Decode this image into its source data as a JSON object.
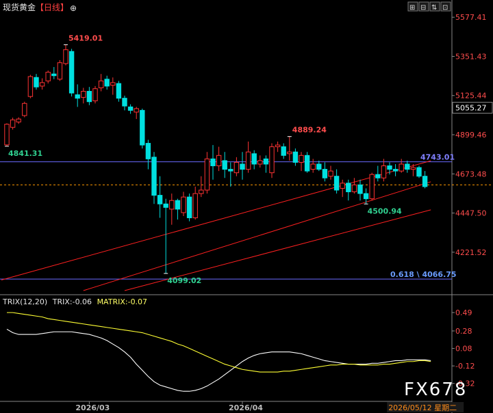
{
  "header": {
    "title": "现货黄金",
    "period": "【日线】",
    "crosshair_icon": "⊕",
    "toolbar": [
      "⊞",
      "⊟",
      "⇅",
      "⊡"
    ]
  },
  "colors": {
    "up": "#ff3333",
    "down": "#00e0e0",
    "background": "#000000",
    "trend_line": "#ff2020",
    "level_line": "#6a6aff",
    "current_price_line": "#ff9900",
    "trix_line": "#ffffff",
    "matrix_line": "#ffff33"
  },
  "chart_data": [
    {
      "type": "candlestick",
      "title": "现货黄金【日线】",
      "ylim": [
        4000,
        5590
      ],
      "y_ticks": [
        5577.41,
        5351.43,
        5125.44,
        4899.46,
        4673.48,
        4447.5,
        4221.52
      ],
      "current_price": 5055.27,
      "x_labels": [
        {
          "label": "2026/03",
          "index": 14
        },
        {
          "label": "2026/04",
          "index": 40
        },
        {
          "label": "2026/05/12 星期二",
          "index": 72,
          "highlight": true
        }
      ],
      "candles": [
        [
          4841,
          4960,
          4833,
          4965
        ],
        [
          4942,
          4985,
          4929,
          4998
        ],
        [
          4973,
          4990,
          4962,
          5000
        ],
        [
          5010,
          5080,
          5000,
          5090
        ],
        [
          5120,
          5235,
          5110,
          5245
        ],
        [
          5230,
          5175,
          5160,
          5250
        ],
        [
          5180,
          5200,
          5160,
          5225
        ],
        [
          5210,
          5260,
          5195,
          5270
        ],
        [
          5250,
          5240,
          5220,
          5290
        ],
        [
          5220,
          5315,
          5210,
          5330
        ],
        [
          5310,
          5390,
          5300,
          5419
        ],
        [
          5380,
          5140,
          5120,
          5395
        ],
        [
          5130,
          5110,
          5060,
          5190
        ],
        [
          5115,
          5150,
          5080,
          5170
        ],
        [
          5150,
          5090,
          5070,
          5175
        ],
        [
          5095,
          5165,
          5080,
          5180
        ],
        [
          5170,
          5210,
          5150,
          5250
        ],
        [
          5220,
          5180,
          5160,
          5240
        ],
        [
          5185,
          5200,
          5130,
          5230
        ],
        [
          5195,
          5110,
          5090,
          5210
        ],
        [
          5110,
          5065,
          5040,
          5125
        ],
        [
          5060,
          5040,
          5020,
          5075
        ],
        [
          5030,
          5050,
          4990,
          5060
        ],
        [
          5040,
          4840,
          4820,
          5050
        ],
        [
          4850,
          4760,
          4700,
          4870
        ],
        [
          4770,
          4550,
          4500,
          4800
        ],
        [
          4550,
          4500,
          4420,
          4660
        ],
        [
          4500,
          4480,
          4099,
          4530
        ],
        [
          4470,
          4520,
          4380,
          4560
        ],
        [
          4520,
          4470,
          4410,
          4530
        ],
        [
          4450,
          4540,
          4430,
          4570
        ],
        [
          4540,
          4420,
          4400,
          4560
        ],
        [
          4420,
          4560,
          4410,
          4600
        ],
        [
          4560,
          4580,
          4540,
          4660
        ],
        [
          4580,
          4760,
          4560,
          4800
        ],
        [
          4760,
          4720,
          4640,
          4840
        ],
        [
          4720,
          4780,
          4690,
          4830
        ],
        [
          4750,
          4700,
          4650,
          4800
        ],
        [
          4700,
          4690,
          4600,
          4740
        ],
        [
          4680,
          4740,
          4660,
          4770
        ],
        [
          4730,
          4700,
          4640,
          4800
        ],
        [
          4700,
          4800,
          4680,
          4860
        ],
        [
          4790,
          4730,
          4700,
          4810
        ],
        [
          4730,
          4750,
          4710,
          4780
        ],
        [
          4760,
          4730,
          4680,
          4780
        ],
        [
          4680,
          4830,
          4650,
          4850
        ],
        [
          4830,
          4840,
          4800,
          4860
        ],
        [
          4830,
          4780,
          4760,
          4850
        ],
        [
          4790,
          4800,
          4750,
          4889
        ],
        [
          4800,
          4740,
          4720,
          4820
        ],
        [
          4740,
          4780,
          4690,
          4800
        ],
        [
          4780,
          4690,
          4680,
          4800
        ],
        [
          4700,
          4730,
          4680,
          4760
        ],
        [
          4730,
          4700,
          4690,
          4750
        ],
        [
          4700,
          4650,
          4630,
          4740
        ],
        [
          4660,
          4690,
          4640,
          4720
        ],
        [
          4660,
          4580,
          4560,
          4700
        ],
        [
          4590,
          4620,
          4540,
          4640
        ],
        [
          4620,
          4570,
          4520,
          4640
        ],
        [
          4570,
          4610,
          4560,
          4650
        ],
        [
          4610,
          4560,
          4520,
          4640
        ],
        [
          4560,
          4530,
          4500,
          4590
        ],
        [
          4530,
          4670,
          4520,
          4680
        ],
        [
          4670,
          4650,
          4630,
          4720
        ],
        [
          4650,
          4720,
          4630,
          4760
        ],
        [
          4720,
          4700,
          4670,
          4740
        ],
        [
          4700,
          4690,
          4660,
          4730
        ],
        [
          4690,
          4730,
          4680,
          4760
        ],
        [
          4730,
          4700,
          4680,
          4750
        ],
        [
          4700,
          4710,
          4660,
          4730
        ],
        [
          4710,
          4660,
          4650,
          4720
        ],
        [
          4660,
          4600,
          4590,
          4690
        ]
      ],
      "annotations": [
        {
          "text": "5419.01",
          "kind": "high",
          "index": 10
        },
        {
          "text": "4841.31",
          "kind": "low",
          "index": 0
        },
        {
          "text": "4889.24",
          "kind": "high",
          "index": 48
        },
        {
          "text": "4099.02",
          "kind": "low",
          "index": 27
        },
        {
          "text": "4500.94",
          "kind": "low",
          "index": 61
        },
        {
          "text": "4743.01",
          "kind": "level",
          "value": 4743.01
        },
        {
          "text": "0.618 \\ 4066.75",
          "kind": "fib",
          "value": 4066.75
        }
      ],
      "trend_lines": [
        {
          "from": [
            0,
            4070
          ],
          "to": [
            72,
            4749
          ]
        },
        {
          "from": [
            13,
            4000
          ],
          "to": [
            72,
            4628
          ]
        },
        {
          "from": [
            20,
            4000
          ],
          "to": [
            72,
            4466
          ]
        }
      ]
    },
    {
      "type": "line",
      "title": "TRIX(12,20)",
      "ylim": [
        -0.33,
        0.53
      ],
      "y_ticks": [
        0.49,
        0.28,
        0.08,
        -0.12,
        -0.32
      ],
      "series": [
        {
          "name": "TRIX",
          "value_label": "-0.06",
          "color": "#ffffff",
          "values": [
            0.3,
            0.26,
            0.24,
            0.24,
            0.24,
            0.24,
            0.25,
            0.26,
            0.27,
            0.27,
            0.27,
            0.27,
            0.26,
            0.25,
            0.24,
            0.22,
            0.2,
            0.17,
            0.13,
            0.09,
            0.04,
            -0.02,
            -0.1,
            -0.17,
            -0.24,
            -0.3,
            -0.34,
            -0.36,
            -0.38,
            -0.4,
            -0.41,
            -0.41,
            -0.4,
            -0.38,
            -0.35,
            -0.31,
            -0.27,
            -0.22,
            -0.17,
            -0.12,
            -0.07,
            -0.03,
            0.0,
            0.02,
            0.03,
            0.04,
            0.04,
            0.04,
            0.04,
            0.03,
            0.02,
            0.0,
            -0.02,
            -0.04,
            -0.06,
            -0.07,
            -0.08,
            -0.09,
            -0.1,
            -0.1,
            -0.1,
            -0.1,
            -0.09,
            -0.09,
            -0.08,
            -0.07,
            -0.06,
            -0.06,
            -0.05,
            -0.05,
            -0.05,
            -0.05,
            -0.06
          ]
        },
        {
          "name": "MATRIX",
          "value_label": "-0.07",
          "color": "#ffff33",
          "values": [
            0.49,
            0.49,
            0.48,
            0.47,
            0.46,
            0.45,
            0.44,
            0.42,
            0.41,
            0.4,
            0.39,
            0.38,
            0.37,
            0.36,
            0.35,
            0.34,
            0.33,
            0.32,
            0.31,
            0.3,
            0.29,
            0.28,
            0.27,
            0.26,
            0.24,
            0.22,
            0.2,
            0.18,
            0.16,
            0.13,
            0.11,
            0.08,
            0.05,
            0.02,
            -0.01,
            -0.04,
            -0.07,
            -0.1,
            -0.12,
            -0.14,
            -0.16,
            -0.17,
            -0.18,
            -0.19,
            -0.19,
            -0.19,
            -0.19,
            -0.18,
            -0.18,
            -0.17,
            -0.16,
            -0.15,
            -0.14,
            -0.13,
            -0.12,
            -0.11,
            -0.11,
            -0.1,
            -0.1,
            -0.1,
            -0.11,
            -0.11,
            -0.11,
            -0.11,
            -0.1,
            -0.1,
            -0.09,
            -0.08,
            -0.07,
            -0.07,
            -0.06,
            -0.06,
            -0.07
          ]
        }
      ]
    }
  ],
  "watermark": "FX678"
}
